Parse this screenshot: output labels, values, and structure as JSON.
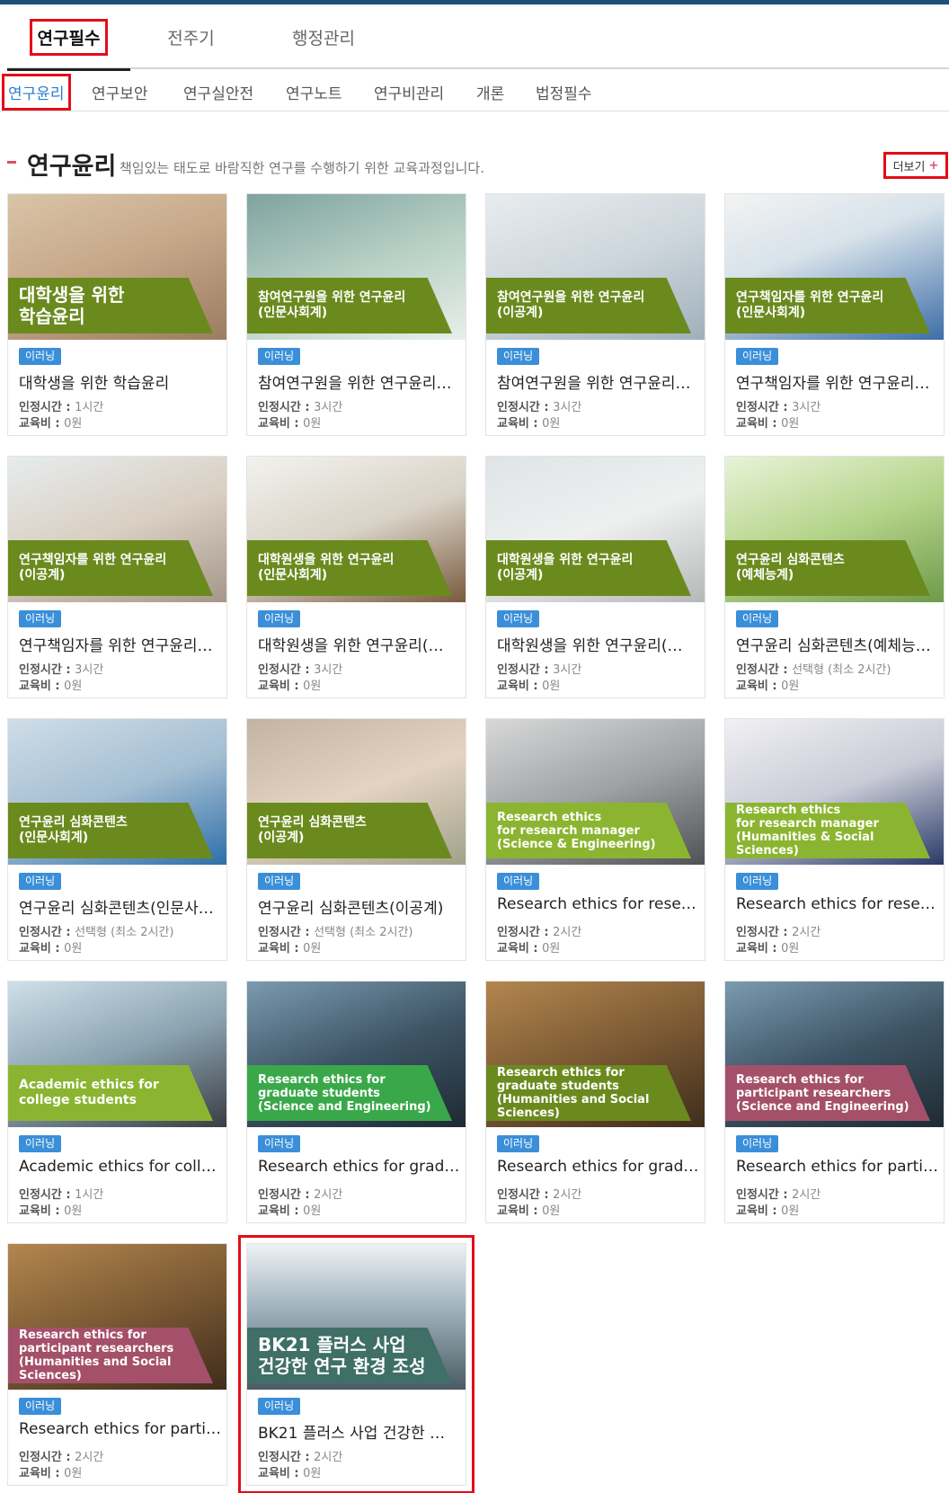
{
  "main_tabs": [
    "연구필수",
    "전주기",
    "행정관리"
  ],
  "sub_tabs": [
    "연구윤리",
    "연구보안",
    "연구실안전",
    "연구노트",
    "연구비관리",
    "개론",
    "법정필수"
  ],
  "section": {
    "title": "연구윤리",
    "description": "책임있는 태도로 바람직한 연구를 수행하기 위한 교육과정입니다.",
    "more_label": "더보기",
    "more_icon": "plus-icon"
  },
  "labels": {
    "hours": "인정시간 : ",
    "fee": "교육비 : "
  },
  "courses": [
    {
      "banner": "대학생을 위한\n학습윤리",
      "badge": "이러닝",
      "title": "대학생을 위한 학습윤리",
      "hours": "1시간",
      "fee": "0원"
    },
    {
      "banner": "참여연구원을 위한 연구윤리\n(인문사회계)",
      "badge": "이러닝",
      "title": "참여연구원을 위한 연구윤리…",
      "hours": "3시간",
      "fee": "0원"
    },
    {
      "banner": "참여연구원을 위한 연구윤리\n(이공계)",
      "badge": "이러닝",
      "title": "참여연구원을 위한 연구윤리…",
      "hours": "3시간",
      "fee": "0원"
    },
    {
      "banner": "연구책임자를 위한 연구윤리\n(인문사회계)",
      "badge": "이러닝",
      "title": "연구책임자를 위한 연구윤리…",
      "hours": "3시간",
      "fee": "0원"
    },
    {
      "banner": "연구책임자를 위한 연구윤리\n(이공계)",
      "badge": "이러닝",
      "title": "연구책임자를 위한 연구윤리…",
      "hours": "3시간",
      "fee": "0원"
    },
    {
      "banner": "대학원생을 위한 연구윤리\n(인문사회계)",
      "badge": "이러닝",
      "title": "대학원생을 위한 연구윤리(…",
      "hours": "3시간",
      "fee": "0원"
    },
    {
      "banner": "대학원생을 위한 연구윤리\n(이공계)",
      "badge": "이러닝",
      "title": "대학원생을 위한 연구윤리(…",
      "hours": "3시간",
      "fee": "0원"
    },
    {
      "banner": "연구윤리 심화콘텐츠\n(예체능계)",
      "badge": "이러닝",
      "title": "연구윤리 심화콘텐츠(예체능…",
      "hours": "선택형 (최소 2시간)",
      "fee": "0원"
    },
    {
      "banner": "연구윤리 심화콘텐츠\n(인문사회계)",
      "badge": "이러닝",
      "title": "연구윤리 심화콘텐츠(인문사…",
      "hours": "선택형 (최소 2시간)",
      "fee": "0원"
    },
    {
      "banner": "연구윤리 심화콘텐츠\n(이공계)",
      "badge": "이러닝",
      "title": "연구윤리 심화콘텐츠(이공계)",
      "hours": "선택형 (최소 2시간)",
      "fee": "0원"
    },
    {
      "banner": "Research ethics\nfor research manager\n(Science & Engineering)",
      "badge": "이러닝",
      "title": "Research ethics for resear…",
      "hours": "2시간",
      "fee": "0원"
    },
    {
      "banner": "Research ethics\nfor research manager\n(Humanities & Social Sciences)",
      "badge": "이러닝",
      "title": "Research ethics for resear…",
      "hours": "2시간",
      "fee": "0원"
    },
    {
      "banner": "Academic ethics for\ncollege students",
      "badge": "이러닝",
      "title": "Academic ethics for colle…",
      "hours": "1시간",
      "fee": "0원"
    },
    {
      "banner": "Research ethics for\ngraduate students\n(Science and Engineering)",
      "badge": "이러닝",
      "title": "Research ethics for gradu…",
      "hours": "2시간",
      "fee": "0원"
    },
    {
      "banner": "Research ethics for\ngraduate students\n(Humanities and Social Sciences)",
      "badge": "이러닝",
      "title": "Research ethics for gradu…",
      "hours": "2시간",
      "fee": "0원"
    },
    {
      "banner": "Research ethics for\nparticipant researchers\n(Science and Engineering)",
      "badge": "이러닝",
      "title": "Research ethics for partici…",
      "hours": "2시간",
      "fee": "0원"
    },
    {
      "banner": "Research ethics for\nparticipant researchers\n(Humanities and Social Sciences)",
      "badge": "이러닝",
      "title": "Research ethics for partici…",
      "hours": "2시간",
      "fee": "0원"
    },
    {
      "banner": "BK21 플러스 사업\n건강한 연구 환경 조성",
      "badge": "이러닝",
      "title": "BK21 플러스 사업 건강한 …",
      "hours": "2시간",
      "fee": "0원"
    }
  ],
  "colors": {
    "accent_red": "#e30d17",
    "badge_blue": "#3a8fd8",
    "active_tab_blue": "#2a7fc9",
    "banner_olive": "#6b8a1e",
    "banner_green": "#3aa84a",
    "banner_lime": "#8bb530",
    "banner_rose": "#a5506a",
    "banner_teal": "#3f6f66"
  }
}
